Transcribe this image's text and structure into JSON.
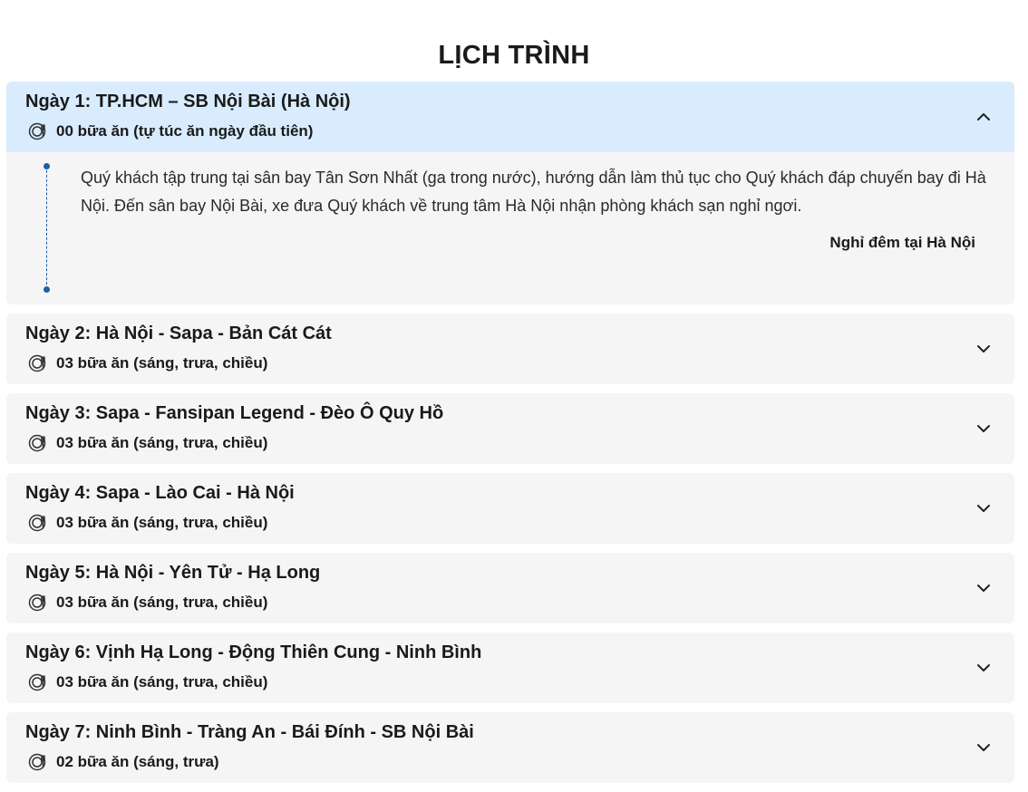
{
  "page": {
    "title": "LỊCH TRÌNH"
  },
  "days": [
    {
      "title": "Ngày 1: TP.HCM – SB Nội Bài (Hà Nội)",
      "meals": "00 bữa ăn (tự túc ăn ngày đầu tiên)",
      "expanded": true,
      "description": "Quý khách tập trung tại sân bay Tân Sơn Nhất (ga trong nước), hướng dẫn làm thủ tục cho Quý khách đáp chuyến bay đi Hà Nội. Đến sân bay Nội Bài, xe đưa Quý khách về trung tâm Hà Nội nhận phòng khách sạn nghỉ ngơi.",
      "overnight": "Nghỉ đêm tại Hà Nội"
    },
    {
      "title": "Ngày 2: Hà Nội - Sapa - Bản Cát Cát",
      "meals": "03 bữa ăn (sáng, trưa, chiều)",
      "expanded": false
    },
    {
      "title": "Ngày 3: Sapa - Fansipan Legend - Đèo Ô Quy Hồ",
      "meals": "03 bữa ăn (sáng, trưa, chiều)",
      "expanded": false
    },
    {
      "title": "Ngày 4: Sapa - Lào Cai - Hà Nội",
      "meals": "03 bữa ăn (sáng, trưa, chiều)",
      "expanded": false
    },
    {
      "title": "Ngày 5: Hà Nội - Yên Tử - Hạ Long",
      "meals": "03 bữa ăn (sáng, trưa, chiều)",
      "expanded": false
    },
    {
      "title": "Ngày 6: Vịnh Hạ Long - Động Thiên Cung - Ninh Bình",
      "meals": "03 bữa ăn (sáng, trưa, chiều)",
      "expanded": false
    },
    {
      "title": "Ngày 7: Ninh Bình - Tràng An - Bái Đính - SB Nội Bài",
      "meals": "02 bữa ăn (sáng, trưa)",
      "expanded": false
    }
  ],
  "icons": {
    "meal": "meal-icon",
    "expanded": "chevron-up-icon",
    "collapsed": "chevron-down-icon"
  },
  "colors": {
    "header_active_bg": "#d8ecfd",
    "item_bg": "#f5f5f5",
    "timeline": "#1f5fa8",
    "text": "#1a1a1a"
  }
}
